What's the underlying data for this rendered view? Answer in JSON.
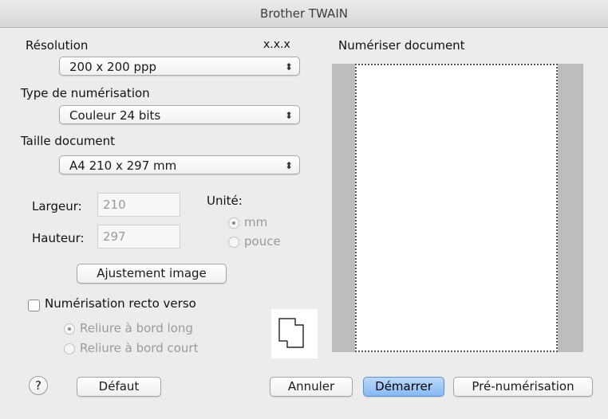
{
  "window": {
    "title": "Brother TWAIN"
  },
  "left": {
    "resolution_label": "Résolution",
    "version": "x.x.x",
    "resolution_value": "200 x 200 ppp",
    "scan_type_label": "Type de numérisation",
    "scan_type_value": "Couleur 24 bits",
    "doc_size_label": "Taille document",
    "doc_size_value": "A4  210 x 297 mm",
    "width_label": "Largeur:",
    "width_value": "210",
    "height_label": "Hauteur:",
    "height_value": "297",
    "unit_label": "Unité:",
    "unit_options": [
      "mm",
      "pouce"
    ],
    "unit_selected": "mm",
    "adjust_button": "Ajustement image",
    "duplex_label": "Numérisation recto verso",
    "duplex_checked": false,
    "binding_options": [
      "Reliure à bord long",
      "Reliure à bord court"
    ],
    "binding_selected": "Reliure à bord long"
  },
  "preview": {
    "title": "Numériser document"
  },
  "footer": {
    "help": "?",
    "default_button": "Défaut",
    "cancel_button": "Annuler",
    "start_button": "Démarrer",
    "prescan_button": "Pré-numérisation"
  },
  "icons": {
    "popup_arrows": "up-down-arrows-icon",
    "duplex_pages": "duplex-pages-icon"
  }
}
